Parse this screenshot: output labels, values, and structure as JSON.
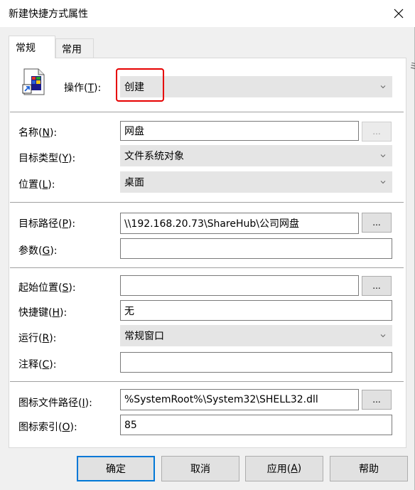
{
  "window": {
    "title": "新建快捷方式属性"
  },
  "stray_char": "ミ",
  "tabs": [
    {
      "label": "常规",
      "active": true
    },
    {
      "label": "常用",
      "active": false
    }
  ],
  "operation": {
    "label_main": "操作(",
    "label_key": "T",
    "label_end": "):",
    "value": "创建"
  },
  "name": {
    "label_main": "名称(",
    "label_key": "N",
    "label_end": "):",
    "value": "网盘",
    "button": "..."
  },
  "target_type": {
    "label_main": "目标类型(",
    "label_key": "Y",
    "label_end": "):",
    "value": "文件系统对象"
  },
  "location": {
    "label_main": "位置(",
    "label_key": "L",
    "label_end": "):",
    "value": "桌面"
  },
  "target_path": {
    "label_main": "目标路径(",
    "label_key": "P",
    "label_end": "):",
    "value": "\\\\192.168.20.73\\ShareHub\\公司网盘",
    "button": "..."
  },
  "arguments": {
    "label_main": "参数(",
    "label_key": "G",
    "label_end": "):",
    "value": ""
  },
  "start_in": {
    "label_main": "起始位置(",
    "label_key": "S",
    "label_end": "):",
    "value": "",
    "button": "..."
  },
  "hotkey": {
    "label_main": "快捷键(",
    "label_key": "H",
    "label_end": "):",
    "value": "无"
  },
  "run": {
    "label_main": "运行(",
    "label_key": "R",
    "label_end": "):",
    "value": "常规窗口"
  },
  "comment": {
    "label_main": "注释(",
    "label_key": "C",
    "label_end": "):",
    "value": ""
  },
  "icon_path": {
    "label_main": "图标文件路径(",
    "label_key": "I",
    "label_end": "):",
    "value": "%SystemRoot%\\System32\\SHELL32.dll",
    "button": "..."
  },
  "icon_index": {
    "label_main": "图标索引(",
    "label_key": "O",
    "label_end": "):",
    "value": "85"
  },
  "buttons": {
    "ok": "确定",
    "cancel": "取消",
    "apply_main": "应用(",
    "apply_key": "A",
    "apply_end": ")",
    "help": "帮助"
  },
  "colors": {
    "highlight_box": "#e60000",
    "default_button_border": "#0078d7"
  },
  "icons": {
    "close": "close-icon",
    "shortcut": "shortcut-file-icon",
    "dropdown": "chevron-down-icon"
  }
}
